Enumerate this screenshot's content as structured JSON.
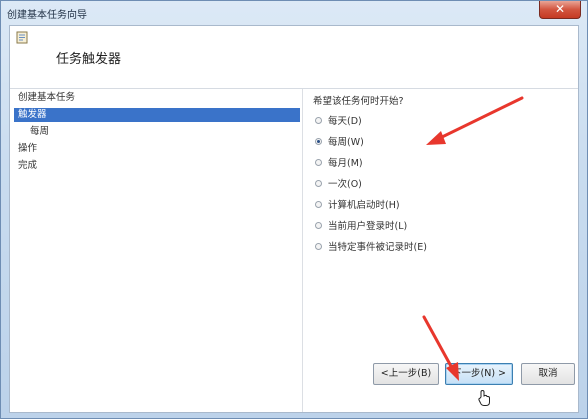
{
  "window": {
    "title": "创建基本任务向导",
    "close_label": "✕"
  },
  "header": {
    "title": "任务触发器",
    "icon": "task-wizard-icon"
  },
  "nav": {
    "items": [
      {
        "label": "创建基本任务",
        "selected": false
      },
      {
        "label": "触发器",
        "selected": true
      },
      {
        "label": "每周",
        "selected": false
      },
      {
        "label": "操作",
        "selected": false
      },
      {
        "label": "完成",
        "selected": false
      }
    ]
  },
  "content": {
    "prompt": "希望该任务何时开始?",
    "options": [
      {
        "label": "每天(D)",
        "checked": false
      },
      {
        "label": "每周(W)",
        "checked": true
      },
      {
        "label": "每月(M)",
        "checked": false
      },
      {
        "label": "一次(O)",
        "checked": false
      },
      {
        "label": "计算机启动时(H)",
        "checked": false
      },
      {
        "label": "当前用户登录时(L)",
        "checked": false
      },
      {
        "label": "当特定事件被记录时(E)",
        "checked": false
      }
    ]
  },
  "buttons": {
    "back": "<上一步(B)",
    "next": "下一步(N) >",
    "cancel": "取消"
  },
  "annotations": {
    "arrow_color": "#e8372d"
  }
}
